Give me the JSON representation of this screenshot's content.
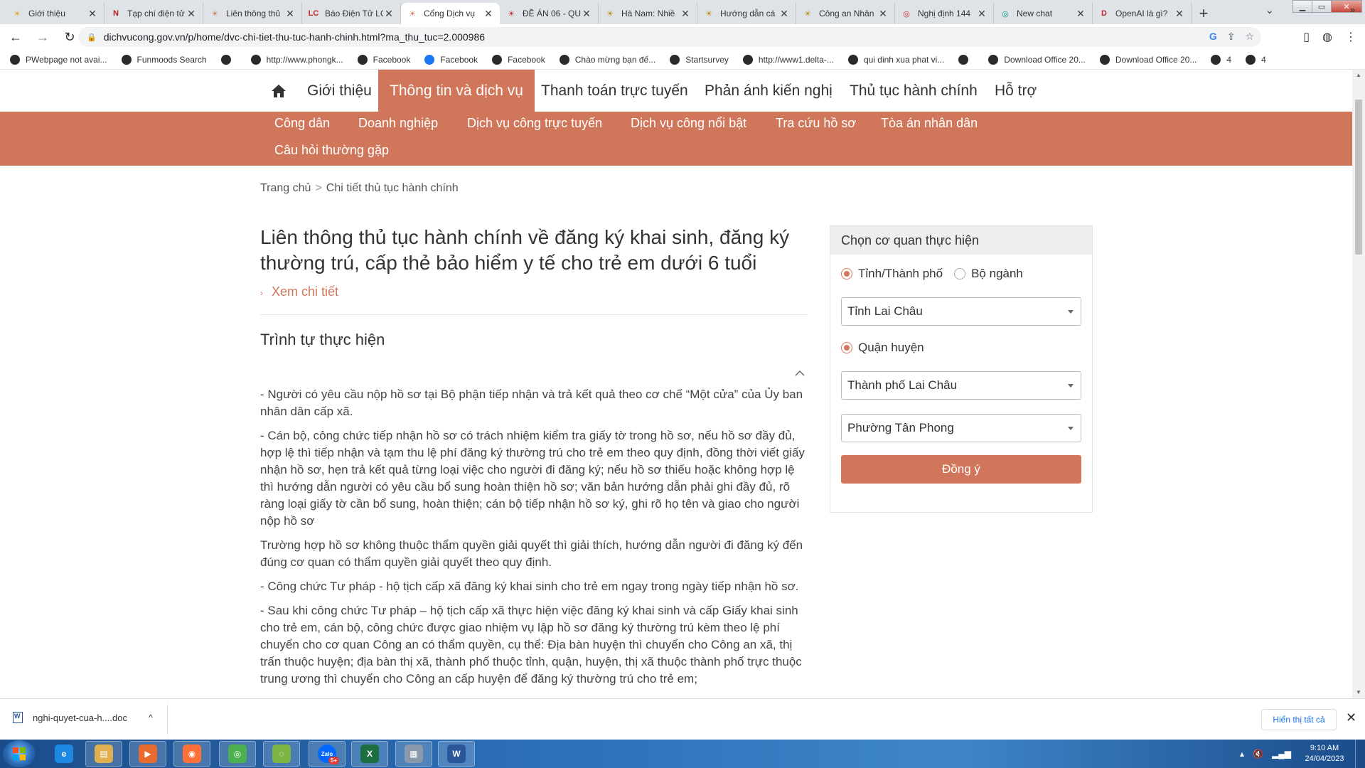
{
  "browser": {
    "tabs": [
      {
        "title": "Giới thiệu",
        "color": "#e0a020",
        "glyph": "☀"
      },
      {
        "title": "Tạp chí điện tử",
        "color": "#b71c1c",
        "glyph": "N"
      },
      {
        "title": "Liên thông thủ",
        "color": "#d0765a",
        "glyph": "☀"
      },
      {
        "title": "Báo Điện Tử LC",
        "color": "#c62828",
        "glyph": "LC"
      },
      {
        "title": "Cổng Dịch vụ",
        "color": "#d0765a",
        "glyph": "☀"
      },
      {
        "title": "ĐỀ ÁN 06 - QU",
        "color": "#c62828",
        "glyph": "☀"
      },
      {
        "title": "Hà Nam: Nhiề",
        "color": "#b8860b",
        "glyph": "☀"
      },
      {
        "title": "Hướng dẫn cá",
        "color": "#b8860b",
        "glyph": "☀"
      },
      {
        "title": "Công an Nhân",
        "color": "#b8860b",
        "glyph": "☀"
      },
      {
        "title": "Nghị định 144",
        "color": "#c62828",
        "glyph": "◎"
      },
      {
        "title": "New chat",
        "color": "#10a37f",
        "glyph": "◎"
      },
      {
        "title": "OpenAI là gì?",
        "color": "#c62828",
        "glyph": "D"
      }
    ],
    "active_tab": 4,
    "url": "dichvucong.gov.vn/p/home/dvc-chi-tiet-thu-tuc-hanh-chinh.html?ma_thu_tuc=2.000986",
    "bookmarks": [
      {
        "label": "PWebpage not avai...",
        "fb": false
      },
      {
        "label": "Funmoods Search",
        "fb": false
      },
      {
        "label": "",
        "fb": false
      },
      {
        "label": "http://www.phongk...",
        "fb": false
      },
      {
        "label": "Facebook",
        "fb": false
      },
      {
        "label": "Facebook",
        "fb": true
      },
      {
        "label": "Facebook",
        "fb": false
      },
      {
        "label": "Chào mừng bạn đế...",
        "fb": false
      },
      {
        "label": "Startsurvey",
        "fb": false
      },
      {
        "label": "http://www1.delta-...",
        "fb": false
      },
      {
        "label": "qui dinh xua phat vi...",
        "fb": false
      },
      {
        "label": "",
        "fb": false
      },
      {
        "label": "Download Office 20...",
        "fb": false
      },
      {
        "label": "Download Office 20...",
        "fb": false
      },
      {
        "label": "4",
        "fb": false
      },
      {
        "label": "4",
        "fb": false
      }
    ],
    "bookmarks_more": "»"
  },
  "nav": {
    "items": [
      "Giới thiệu",
      "Thông tin và dịch vụ",
      "Thanh toán trực tuyến",
      "Phản ánh kiến nghị",
      "Thủ tục hành chính",
      "Hỗ trợ"
    ],
    "active": 1,
    "sub": [
      "Công dân",
      "Doanh nghiệp",
      "Dịch vụ công trực tuyến",
      "Dịch vụ công nổi bật",
      "Tra cứu hồ sơ",
      "Tòa án nhân dân",
      "Câu hỏi thường gặp"
    ]
  },
  "breadcrumb": {
    "home": "Trang chủ",
    "sep": ">",
    "current": "Chi tiết thủ tục hành chính"
  },
  "procedure": {
    "title": "Liên thông thủ tục hành chính về đăng ký khai sinh, đăng ký thường trú, cấp thẻ bảo hiểm y tế cho trẻ em dưới 6 tuổi",
    "detail_link": "Xem chi tiết",
    "section_title": "Trình tự thực hiện",
    "paragraphs": [
      "- Người có yêu cầu nộp hồ sơ tại Bộ phận tiếp nhận và trả kết quả theo cơ chế “Một cửa” của Ủy ban nhân dân cấp xã.",
      "- Cán bộ, công chức tiếp nhận hồ sơ có trách nhiệm kiểm tra giấy tờ trong hồ sơ, nếu hồ sơ đầy đủ, hợp lệ thì tiếp nhận và tạm thu lệ phí đăng ký thường trú cho trẻ em theo quy định, đồng thời viết giấy nhận hồ sơ, hẹn trả kết quả từng loại việc cho người đi đăng ký; nếu hồ sơ thiếu hoặc không hợp lệ thì hướng dẫn người có yêu cầu bổ sung hoàn thiện hồ sơ; văn bản hướng dẫn phải ghi đầy đủ, rõ ràng loại giấy tờ cần bổ sung, hoàn thiện; cán bộ tiếp nhận hồ sơ ký, ghi rõ họ tên và giao cho người nộp hồ sơ",
      "Trường hợp hồ sơ không thuộc thẩm quyền giải quyết thì giải thích, hướng dẫn người đi đăng ký đến đúng cơ quan có thẩm quyền giải quyết theo quy định.",
      "- Công chức Tư pháp - hộ tịch cấp xã đăng ký khai sinh cho trẻ em ngay trong ngày tiếp nhận hồ sơ.",
      "- Sau khi công chức Tư pháp – hộ tịch cấp xã thực hiện việc đăng ký khai sinh và cấp Giấy khai sinh cho trẻ em, cán bộ, công chức được giao nhiệm vụ lập hồ sơ đăng ký thường trú kèm theo lệ phí chuyển cho cơ quan Công an có thẩm quyền, cụ thể: Địa bàn huyện thì chuyển cho Công an xã, thị trấn thuộc huyện; địa bàn thị xã, thành phố thuộc tỉnh, quận, huyện, thị xã thuộc thành phố trực thuộc trung ương thì chuyển cho Công an cấp huyện để đăng ký thường trú cho trẻ em;"
    ]
  },
  "agency_panel": {
    "title": "Chọn cơ quan thực hiện",
    "radio_province": "Tỉnh/Thành phố",
    "radio_ministry": "Bộ ngành",
    "province_value": "Tỉnh Lai Châu",
    "radio_district": "Quận huyện",
    "district_value": "Thành phố Lai Châu",
    "ward_value": "Phường Tân Phong",
    "submit_label": "Đồng ý"
  },
  "download_bar": {
    "file": "nghi-quyet-cua-h....doc",
    "show_all": "Hiển thị tất cả",
    "close": "✕"
  },
  "taskbar": {
    "apps": [
      {
        "name": "internet-explorer",
        "glyph": "e",
        "color": "#1e88e5"
      },
      {
        "name": "file-explorer",
        "glyph": "▤",
        "color": "#e0b050"
      },
      {
        "name": "media-player",
        "glyph": "▶",
        "color": "#e86a2c"
      },
      {
        "name": "firefox",
        "glyph": "◉",
        "color": "#ff7139"
      },
      {
        "name": "chrome",
        "glyph": "◎",
        "color": "#4caf50"
      },
      {
        "name": "coc-coc",
        "glyph": "◌",
        "color": "#7cb342"
      },
      {
        "name": "zalo",
        "glyph": "Zalo",
        "color": "#0068ff"
      },
      {
        "name": "excel",
        "glyph": "X",
        "color": "#1d6f42"
      },
      {
        "name": "calculator",
        "glyph": "▦",
        "color": "#8a9aab"
      },
      {
        "name": "word",
        "glyph": "W",
        "color": "#2b579a"
      }
    ],
    "zalo_badge": "5+",
    "time": "9:10 AM",
    "date": "24/04/2023"
  },
  "colors": {
    "accent": "#d0765a",
    "link": "#1a73e8"
  }
}
